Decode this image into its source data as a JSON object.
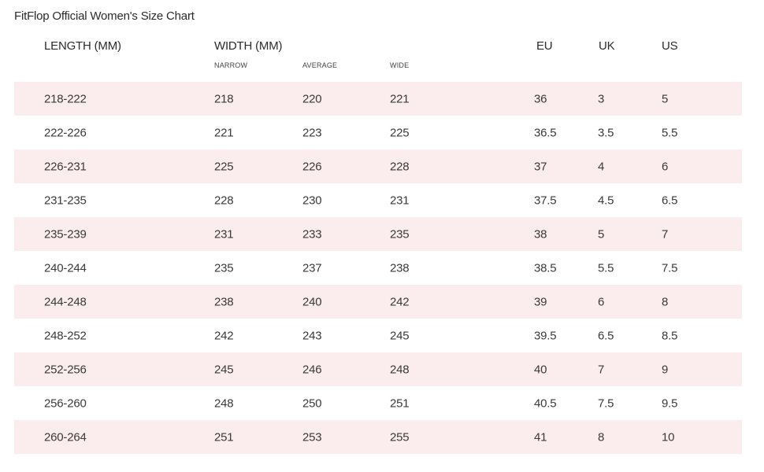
{
  "title": "FitFlop Official Women's Size Chart",
  "headers": {
    "length": "LENGTH (MM)",
    "width": "WIDTH (MM)",
    "narrow": "NARROW",
    "average": "AVERAGE",
    "wide": "WIDE",
    "eu": "EU",
    "uk": "UK",
    "us": "US"
  },
  "colors": {
    "row_shade": "#fbeced",
    "text": "#333333"
  },
  "rows": [
    {
      "length": "218-222",
      "narrow": "218",
      "average": "220",
      "wide": "221",
      "eu": "36",
      "uk": "3",
      "us": "5"
    },
    {
      "length": "222-226",
      "narrow": "221",
      "average": "223",
      "wide": "225",
      "eu": "36.5",
      "uk": "3.5",
      "us": "5.5"
    },
    {
      "length": "226-231",
      "narrow": "225",
      "average": "226",
      "wide": "228",
      "eu": "37",
      "uk": "4",
      "us": "6"
    },
    {
      "length": "231-235",
      "narrow": "228",
      "average": "230",
      "wide": "231",
      "eu": "37.5",
      "uk": "4.5",
      "us": "6.5"
    },
    {
      "length": "235-239",
      "narrow": "231",
      "average": "233",
      "wide": "235",
      "eu": "38",
      "uk": "5",
      "us": "7"
    },
    {
      "length": "240-244",
      "narrow": "235",
      "average": "237",
      "wide": "238",
      "eu": "38.5",
      "uk": "5.5",
      "us": "7.5"
    },
    {
      "length": "244-248",
      "narrow": "238",
      "average": "240",
      "wide": "242",
      "eu": "39",
      "uk": "6",
      "us": "8"
    },
    {
      "length": "248-252",
      "narrow": "242",
      "average": "243",
      "wide": "245",
      "eu": "39.5",
      "uk": "6.5",
      "us": "8.5"
    },
    {
      "length": "252-256",
      "narrow": "245",
      "average": "246",
      "wide": "248",
      "eu": "40",
      "uk": "7",
      "us": "9"
    },
    {
      "length": "256-260",
      "narrow": "248",
      "average": "250",
      "wide": "251",
      "eu": "40.5",
      "uk": "7.5",
      "us": "9.5"
    },
    {
      "length": "260-264",
      "narrow": "251",
      "average": "253",
      "wide": "255",
      "eu": "41",
      "uk": "8",
      "us": "10"
    }
  ]
}
